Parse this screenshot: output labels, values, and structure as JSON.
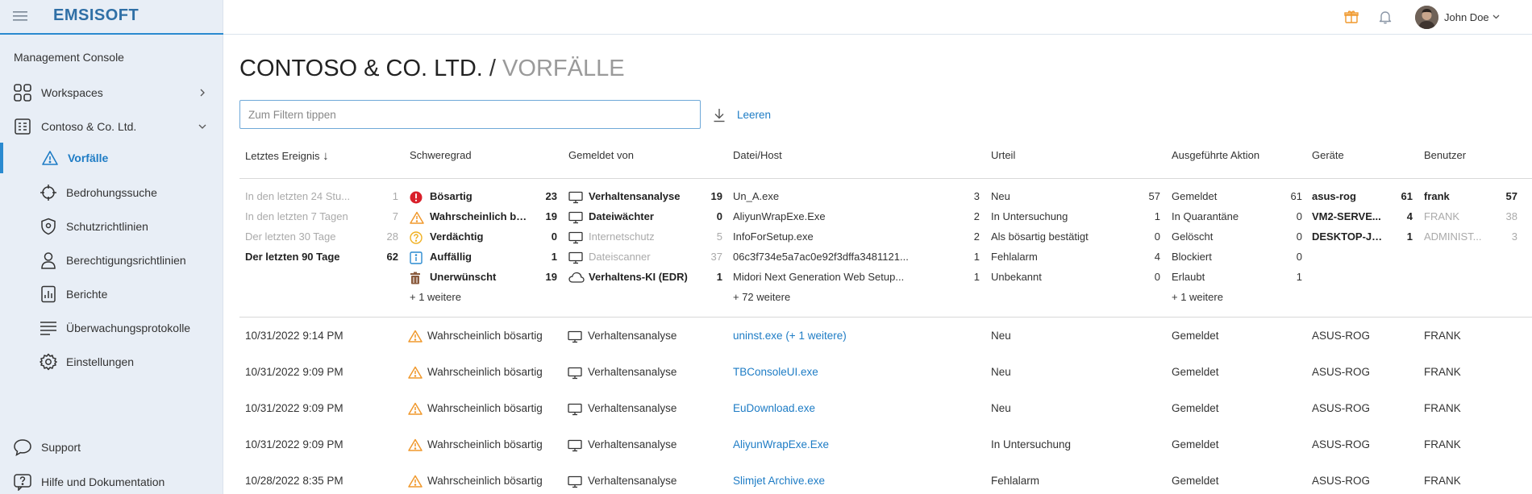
{
  "app": {
    "logo": "EMSISOFT"
  },
  "sidebar": {
    "console_title": "Management Console",
    "workspaces": "Workspaces",
    "company": "Contoso & Co. Ltd.",
    "items": [
      "Vorfälle",
      "Bedrohungssuche",
      "Schutzrichtlinien",
      "Berechtigungsrichtlinien",
      "Berichte",
      "Überwachungsprotokolle",
      "Einstellungen"
    ],
    "support": "Support",
    "help": "Hilfe und Dokumentation"
  },
  "header": {
    "user_name": "John Doe"
  },
  "page": {
    "org": "CONTOSO & CO. LTD.",
    "separator": "/",
    "section": "VORFÄLLE"
  },
  "filter": {
    "placeholder": "Zum Filtern tippen",
    "value": "",
    "clear_label": "Leeren"
  },
  "columns": [
    "Letztes Ereignis",
    "Schweregrad",
    "Gemeldet von",
    "Datei/Host",
    "Urteil",
    "Ausgeführte Aktion",
    "Geräte",
    "Benutzer"
  ],
  "sort_indicator": "↓",
  "facets": {
    "time": [
      {
        "label": "In den letzten 24 Stu...",
        "count": "1",
        "style": "g"
      },
      {
        "label": "In den letzten 7 Tagen",
        "count": "7",
        "style": "g"
      },
      {
        "label": "Der letzten 30 Tage",
        "count": "28",
        "style": "g"
      },
      {
        "label": "Der letzten 90 Tage",
        "count": "62",
        "style": "b"
      }
    ],
    "severity": [
      {
        "label": "Bösartig",
        "count": "23",
        "icon": "malicious-icon"
      },
      {
        "label": "Wahrscheinlich bös...",
        "count": "19",
        "icon": "warning-icon"
      },
      {
        "label": "Verdächtig",
        "count": "0",
        "icon": "question-icon"
      },
      {
        "label": "Auffällig",
        "count": "1",
        "icon": "info-icon"
      },
      {
        "label": "Unerwünscht",
        "count": "19",
        "icon": "trash-icon"
      }
    ],
    "severity_more": "+ 1 weitere",
    "reporter": [
      {
        "label": "Verhaltensanalyse",
        "count": "19",
        "style": "b",
        "icon": "monitor-icon"
      },
      {
        "label": "Dateiwächter",
        "count": "0",
        "style": "b",
        "icon": "monitor-icon"
      },
      {
        "label": "Internetschutz",
        "count": "5",
        "style": "g",
        "icon": "monitor-icon"
      },
      {
        "label": "Dateiscanner",
        "count": "37",
        "style": "g",
        "icon": "monitor-icon"
      },
      {
        "label": "Verhaltens-KI (EDR)",
        "count": "1",
        "style": "b",
        "icon": "cloud-icon"
      }
    ],
    "file": [
      {
        "label": "Un_A.exe",
        "count": "3"
      },
      {
        "label": "AliyunWrapExe.Exe",
        "count": "2"
      },
      {
        "label": "InfoForSetup.exe",
        "count": "2"
      },
      {
        "label": "06c3f734e5a7ac0e92f3dffa3481121...",
        "count": "1"
      },
      {
        "label": "Midori Next Generation Web Setup...",
        "count": "1"
      }
    ],
    "file_more": "+ 72 weitere",
    "verdict": [
      {
        "label": "Neu",
        "count": "57"
      },
      {
        "label": "In Untersuchung",
        "count": "1"
      },
      {
        "label": "Als bösartig bestätigt",
        "count": "0"
      },
      {
        "label": "Fehlalarm",
        "count": "4"
      },
      {
        "label": "Unbekannt",
        "count": "0"
      }
    ],
    "action": [
      {
        "label": "Gemeldet",
        "count": "61"
      },
      {
        "label": "In Quarantäne",
        "count": "0"
      },
      {
        "label": "Gelöscht",
        "count": "0"
      },
      {
        "label": "Blockiert",
        "count": "0"
      },
      {
        "label": "Erlaubt",
        "count": "1"
      }
    ],
    "action_more": "+ 1 weitere",
    "devices": [
      {
        "label": "asus-rog",
        "count": "61",
        "style": "b"
      },
      {
        "label": "VM2-SERVE...",
        "count": "4",
        "style": "b"
      },
      {
        "label": "DESKTOP-JH...",
        "count": "1",
        "style": "b"
      }
    ],
    "users": [
      {
        "label": "frank",
        "count": "57",
        "style": "b"
      },
      {
        "label": "FRANK",
        "count": "38",
        "style": "g"
      },
      {
        "label": "ADMINIST...",
        "count": "3",
        "style": "g"
      }
    ]
  },
  "rows": [
    {
      "date": "10/31/2022 9:14 PM",
      "severity": "Wahrscheinlich bösartig",
      "reporter": "Verhaltensanalyse",
      "file": "uninst.exe",
      "file_extra": "(+ 1 weitere)",
      "verdict": "Neu",
      "action": "Gemeldet",
      "device": "ASUS-ROG",
      "user": "FRANK"
    },
    {
      "date": "10/31/2022 9:09 PM",
      "severity": "Wahrscheinlich bösartig",
      "reporter": "Verhaltensanalyse",
      "file": "TBConsoleUI.exe",
      "file_extra": "",
      "verdict": "Neu",
      "action": "Gemeldet",
      "device": "ASUS-ROG",
      "user": "FRANK"
    },
    {
      "date": "10/31/2022 9:09 PM",
      "severity": "Wahrscheinlich bösartig",
      "reporter": "Verhaltensanalyse",
      "file": "EuDownload.exe",
      "file_extra": "",
      "verdict": "Neu",
      "action": "Gemeldet",
      "device": "ASUS-ROG",
      "user": "FRANK"
    },
    {
      "date": "10/31/2022 9:09 PM",
      "severity": "Wahrscheinlich bösartig",
      "reporter": "Verhaltensanalyse",
      "file": "AliyunWrapExe.Exe",
      "file_extra": "",
      "verdict": "In Untersuchung",
      "action": "Gemeldet",
      "device": "ASUS-ROG",
      "user": "FRANK"
    },
    {
      "date": "10/28/2022 8:35 PM",
      "severity": "Wahrscheinlich bösartig",
      "reporter": "Verhaltensanalyse",
      "file": "Slimjet Archive.exe",
      "file_extra": "",
      "verdict": "Fehlalarm",
      "action": "Gemeldet",
      "device": "ASUS-ROG",
      "user": "FRANK"
    }
  ],
  "colors": {
    "accent": "#1e7cc5",
    "warning": "#f0982c",
    "malicious": "#d9202b",
    "suspicious": "#f0b020",
    "info": "#2a8ad0",
    "trash": "#8a5a3c"
  }
}
